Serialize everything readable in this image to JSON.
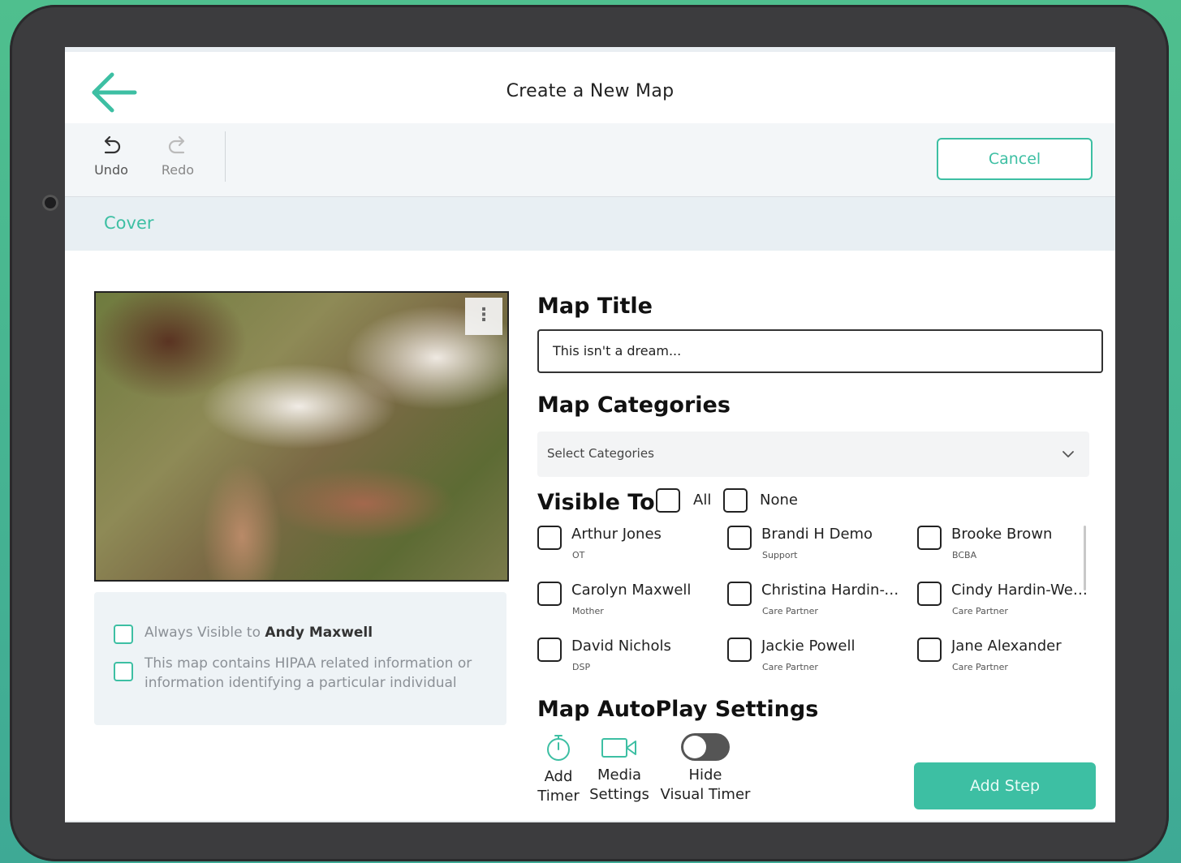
{
  "header": {
    "title": "Create a New Map",
    "back_icon": "arrow-left-icon"
  },
  "toolbar": {
    "undo_label": "Undo",
    "redo_label": "Redo",
    "cancel_label": "Cancel"
  },
  "section": {
    "label": "Cover"
  },
  "cover": {
    "image_icon": "photo-image",
    "menu_glyph": "⋮"
  },
  "options": {
    "always_visible_prefix": "Always Visible to ",
    "always_visible_name": "Andy Maxwell",
    "hipaa_text_line1": "This map contains HIPAA related information or",
    "hipaa_text_line2": "information identifying a particular individual"
  },
  "form": {
    "map_title_label": "Map Title",
    "map_title_value": "This isn't a dream...",
    "categories_label": "Map Categories",
    "categories_placeholder": "Select Categories",
    "visible_to_label": "Visible To:",
    "all_label": "All",
    "none_label": "None",
    "autoplay_label": "Map AutoPlay Settings"
  },
  "people": [
    {
      "name": "Arthur Jones",
      "role": "OT"
    },
    {
      "name": "Brandi H Demo",
      "role": "Support"
    },
    {
      "name": "Brooke Brown",
      "role": "BCBA"
    },
    {
      "name": "Carolyn Maxwell",
      "role": "Mother"
    },
    {
      "name": "Christina Hardin-W...",
      "role": "Care Partner"
    },
    {
      "name": "Cindy Hardin-Weis...",
      "role": "Care Partner"
    },
    {
      "name": "David Nichols",
      "role": "DSP"
    },
    {
      "name": "Jackie Powell",
      "role": "Care Partner"
    },
    {
      "name": "Jane Alexander",
      "role": "Care Partner"
    }
  ],
  "autoplay": {
    "timer_line1": "Add",
    "timer_line2": "Timer",
    "media_line1": "Media",
    "media_line2": "Settings",
    "hide_line1": "Hide",
    "hide_line2": "Visual Timer",
    "hide_visual_timer_on": false
  },
  "actions": {
    "add_step_label": "Add Step"
  },
  "colors": {
    "accent": "#3dbfa3",
    "text": "#222222",
    "panel": "#eef3f6"
  }
}
